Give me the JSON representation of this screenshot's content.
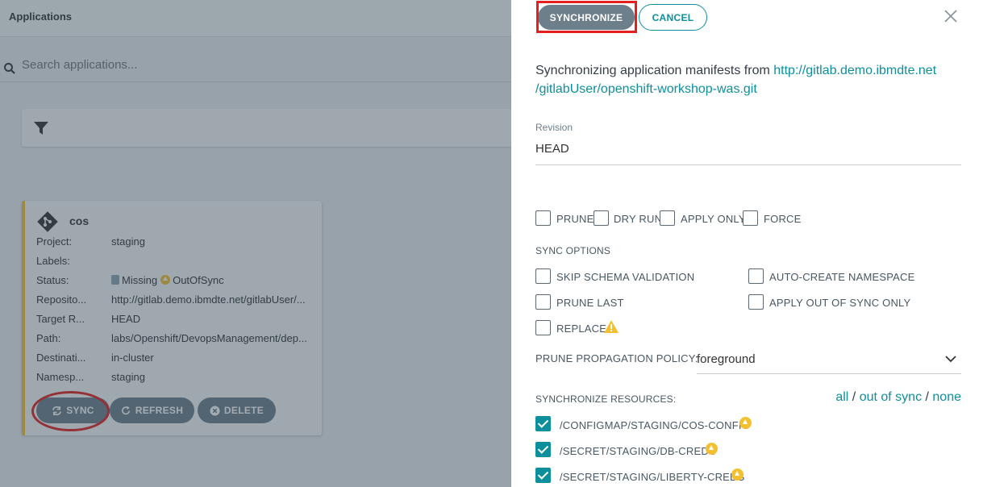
{
  "background_app": {
    "title": "Applications",
    "search_placeholder": "Search applications...",
    "card": {
      "name": "cos",
      "rows": [
        {
          "key": "Project:",
          "value": "staging"
        },
        {
          "key": "Labels:",
          "value": ""
        },
        {
          "key": "Status:",
          "value": ""
        },
        {
          "key": "Reposito...",
          "value": "http://gitlab.demo.ibmdte.net/gitlabUser/..."
        },
        {
          "key": "Target R...",
          "value": "HEAD"
        },
        {
          "key": "Path:",
          "value": "labs/Openshift/DevopsManagement/dep..."
        },
        {
          "key": "Destinati...",
          "value": "in-cluster"
        },
        {
          "key": "Namesp...",
          "value": "staging"
        }
      ],
      "status_health": "Missing",
      "status_sync": "OutOfSync",
      "sync_label": "SYNC",
      "refresh_label": "REFRESH",
      "delete_label": "DELETE"
    }
  },
  "panel": {
    "synchronize_label": "SYNCHRONIZE",
    "cancel_label": "CANCEL",
    "intro_text": "Synchronizing application manifests from ",
    "repo_url_line1": "http://gitlab.demo.ibmdte.net",
    "repo_url_line2": "/gitlabUser/openshift-workshop-was.git",
    "revision_label": "Revision",
    "revision_value": "HEAD",
    "options": {
      "prune": "PRUNE",
      "dry_run": "DRY RUN",
      "apply_only": "APPLY ONLY",
      "force": "FORCE"
    },
    "sync_options_title": "SYNC OPTIONS",
    "sync_options": {
      "skip_schema": "SKIP SCHEMA VALIDATION",
      "auto_create_ns": "AUTO-CREATE NAMESPACE",
      "prune_last": "PRUNE LAST",
      "apply_out_of_sync": "APPLY OUT OF SYNC ONLY",
      "replace": "REPLACE"
    },
    "prune_policy_label": "PRUNE PROPAGATION POLICY:",
    "prune_policy_value": "foreground",
    "sync_resources_label": "SYNCHRONIZE RESOURCES:",
    "res_links": {
      "all": "all",
      "sep": " / ",
      "out_of_sync": "out of sync",
      "none": "none"
    },
    "resources": [
      "/CONFIGMAP/STAGING/COS-CONFIG",
      "/SECRET/STAGING/DB-CREDS",
      "/SECRET/STAGING/LIBERTY-CREDS"
    ]
  },
  "colors": {
    "accent": "#0e8f9c",
    "button_gray": "#6d7f8b",
    "warning": "#f4c030",
    "highlight_red": "#e41f1f"
  }
}
